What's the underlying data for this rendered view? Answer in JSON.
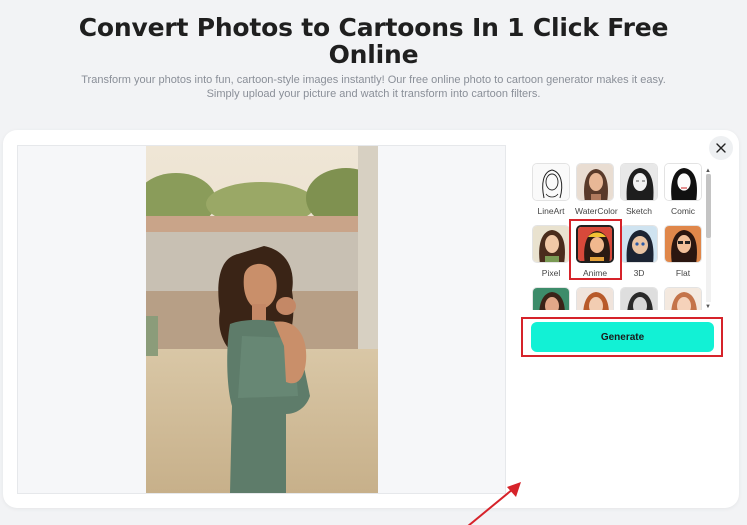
{
  "hero": {
    "title": "Convert Photos to Cartoons In 1 Click Free Online",
    "subtitle": "Transform your photos into fun, cartoon-style images instantly! Our free online photo to cartoon generator makes it easy. Simply upload your picture and watch it transform into cartoon filters."
  },
  "editor": {
    "close_icon": "close-icon",
    "filters": [
      {
        "label": "LineArt",
        "icon": "lineart-thumb"
      },
      {
        "label": "WaterColor",
        "icon": "watercolor-thumb"
      },
      {
        "label": "Sketch",
        "icon": "sketch-thumb"
      },
      {
        "label": "Comic",
        "icon": "comic-thumb"
      },
      {
        "label": "Pixel",
        "icon": "pixel-thumb"
      },
      {
        "label": "Anime",
        "icon": "anime-thumb",
        "selected": true
      },
      {
        "label": "3D",
        "icon": "3d-thumb"
      },
      {
        "label": "Flat",
        "icon": "flat-thumb"
      }
    ],
    "generate_label": "Generate"
  },
  "colors": {
    "accent": "#12f1d5",
    "highlight": "#d6232a",
    "background": "#f2f3f5"
  }
}
